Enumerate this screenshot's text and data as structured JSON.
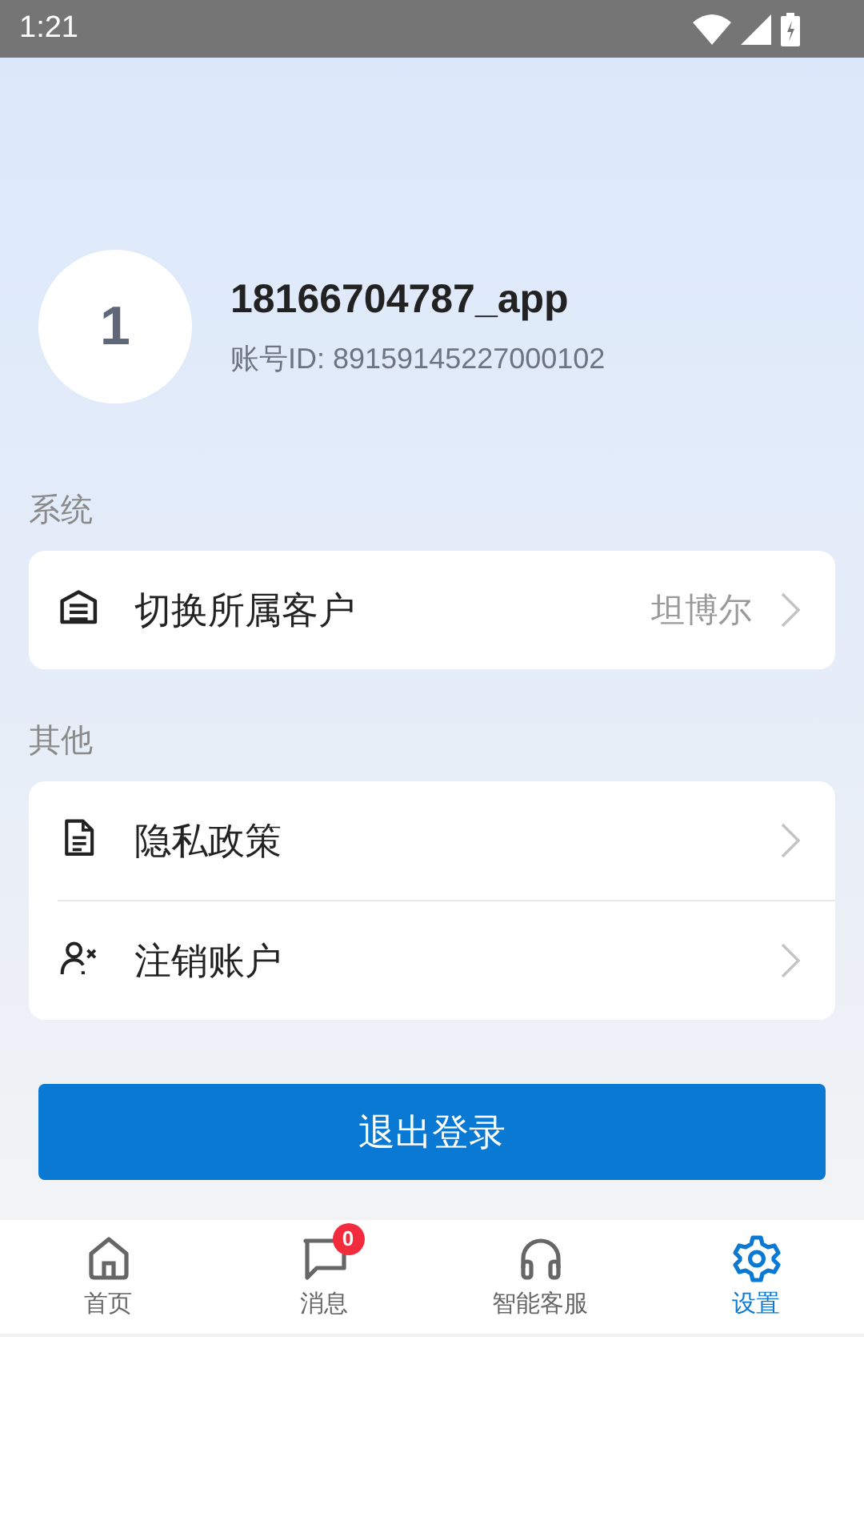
{
  "status_bar": {
    "time": "1:21"
  },
  "profile": {
    "avatar_text": "1",
    "name": "18166704787_app",
    "account_id": "账号ID: 89159145227000102"
  },
  "sections": [
    {
      "title": "系统",
      "items": [
        {
          "kind": "building",
          "label": "切换所属客户",
          "value": "坦博尔"
        }
      ]
    },
    {
      "title": "其他",
      "items": [
        {
          "kind": "document",
          "label": "隐私政策"
        },
        {
          "kind": "user-remove",
          "label": "注销账户"
        }
      ]
    }
  ],
  "logout_button": "退出登录",
  "tab_bar": [
    {
      "kind": "home",
      "label": "首页",
      "selected": false
    },
    {
      "kind": "chat",
      "label": "消息",
      "selected": false,
      "badge": "0"
    },
    {
      "kind": "headset",
      "label": "智能客服",
      "selected": false
    },
    {
      "kind": "gear",
      "label": "设置",
      "selected": true
    }
  ]
}
